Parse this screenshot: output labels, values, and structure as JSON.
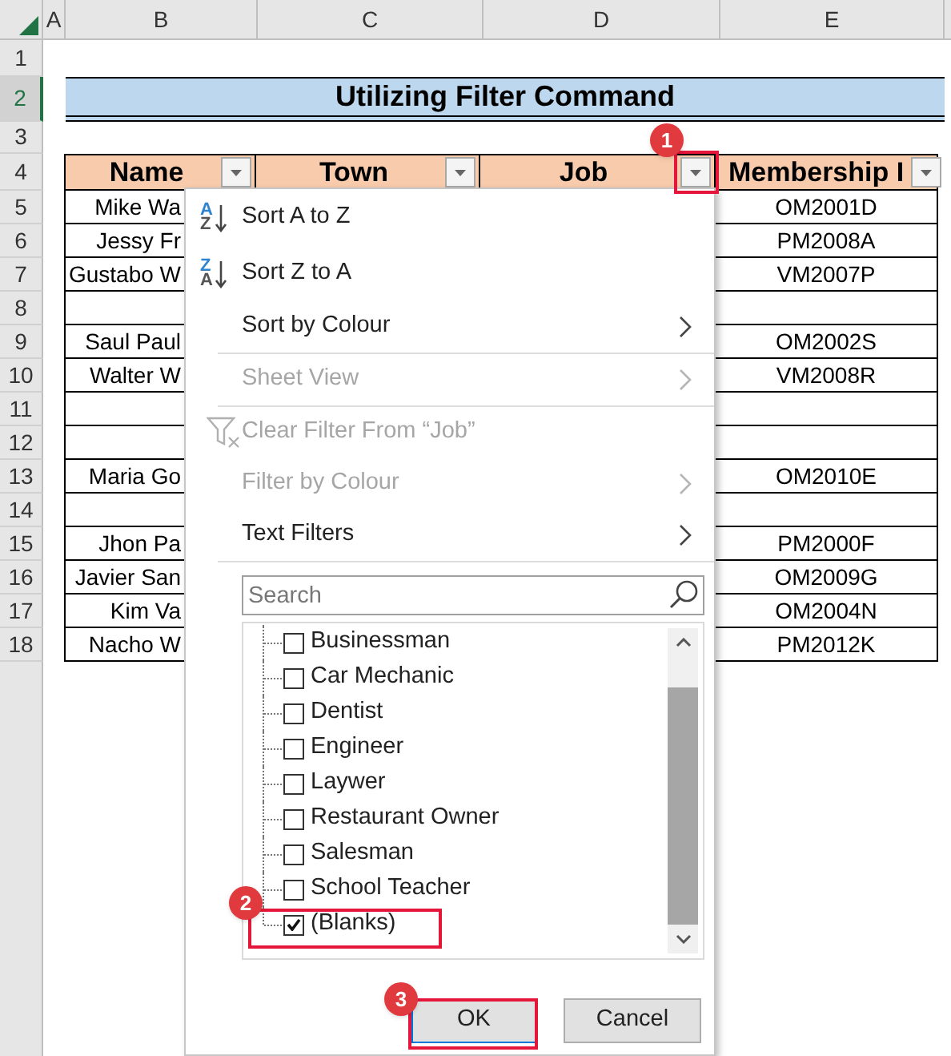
{
  "column_headers": [
    {
      "label": "A",
      "selected": false
    },
    {
      "label": "B",
      "selected": false
    },
    {
      "label": "C",
      "selected": false
    },
    {
      "label": "D",
      "selected": false
    },
    {
      "label": "E",
      "selected": false
    }
  ],
  "row_headers": [
    {
      "label": "1",
      "selected": false
    },
    {
      "label": "2",
      "selected": true
    },
    {
      "label": "3",
      "selected": false
    },
    {
      "label": "4",
      "selected": false
    },
    {
      "label": "5",
      "selected": false
    },
    {
      "label": "6",
      "selected": false
    },
    {
      "label": "7",
      "selected": false
    },
    {
      "label": "8",
      "selected": false
    },
    {
      "label": "9",
      "selected": false
    },
    {
      "label": "10",
      "selected": false
    },
    {
      "label": "11",
      "selected": false
    },
    {
      "label": "12",
      "selected": false
    },
    {
      "label": "13",
      "selected": false
    },
    {
      "label": "14",
      "selected": false
    },
    {
      "label": "15",
      "selected": false
    },
    {
      "label": "16",
      "selected": false
    },
    {
      "label": "17",
      "selected": false
    },
    {
      "label": "18",
      "selected": false
    }
  ],
  "title": "Utilizing Filter Command",
  "table": {
    "columns": [
      {
        "label": "Name"
      },
      {
        "label": "Town"
      },
      {
        "label": "Job",
        "annotation": "1"
      },
      {
        "label": "Membership I"
      }
    ],
    "rows": [
      {
        "name": "Mike Wa",
        "membership": "OM2001D"
      },
      {
        "name": "Jessy Fr",
        "membership": "PM2008A"
      },
      {
        "name": "Gustabo W",
        "membership": "VM2007P"
      },
      {},
      {
        "name": "Saul Paul",
        "membership": "OM2002S"
      },
      {
        "name": "Walter W",
        "membership": "VM2008R"
      },
      {},
      {},
      {
        "name": "Maria Go",
        "membership": "OM2010E"
      },
      {},
      {
        "name": "Jhon Pa",
        "membership": "PM2000F"
      },
      {
        "name": "Javier San",
        "membership": "OM2009G"
      },
      {
        "name": "Kim Va",
        "membership": "OM2004N"
      },
      {
        "name": "Nacho W",
        "membership": "PM2012K"
      }
    ]
  },
  "filter_menu": {
    "items": [
      {
        "kind": "sort",
        "label": "Sort A to Z",
        "icon_letters": [
          "A",
          "Z"
        ],
        "disabled": false,
        "submenu": false
      },
      {
        "kind": "sort",
        "label": "Sort Z to A",
        "icon_letters": [
          "Z",
          "A"
        ],
        "disabled": false,
        "submenu": false
      },
      {
        "kind": "plain",
        "label": "Sort by Colour",
        "disabled": false,
        "submenu": true
      },
      {
        "kind": "separator"
      },
      {
        "kind": "plain",
        "label": "Sheet View",
        "disabled": true,
        "submenu": true
      },
      {
        "kind": "separator"
      },
      {
        "kind": "clear",
        "label": "Clear Filter From “Job”",
        "disabled": true,
        "submenu": false
      },
      {
        "kind": "plain",
        "label": "Filter by Colour",
        "disabled": true,
        "submenu": true
      },
      {
        "kind": "plain",
        "label": "Text Filters",
        "disabled": false,
        "submenu": true
      },
      {
        "kind": "separator"
      }
    ],
    "search": {
      "placeholder": "Search"
    },
    "options": [
      {
        "label": "Businessman",
        "checked": false
      },
      {
        "label": "Car Mechanic",
        "checked": false
      },
      {
        "label": "Dentist",
        "checked": false
      },
      {
        "label": "Engineer",
        "checked": false
      },
      {
        "label": "Laywer",
        "checked": false
      },
      {
        "label": "Restaurant Owner",
        "checked": false
      },
      {
        "label": "Salesman",
        "checked": false
      },
      {
        "label": "School Teacher",
        "checked": false
      },
      {
        "label": "(Blanks)",
        "checked": true,
        "annotation": "2"
      }
    ],
    "buttons": [
      {
        "label": "OK",
        "annotation": "3"
      },
      {
        "label": "Cancel"
      }
    ]
  }
}
